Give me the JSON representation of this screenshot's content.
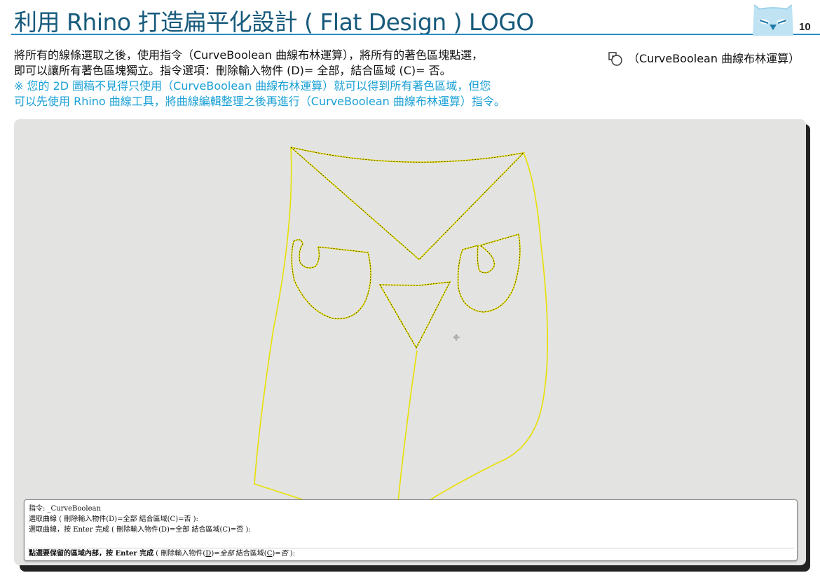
{
  "header": {
    "title": "利用 Rhino 打造扁平化設計 ( Flat Design ) LOGO",
    "page_number": "10"
  },
  "description": {
    "line1": "將所有的線條選取之後，使用指令（CurveBoolean 曲線布林運算），將所有的著色區塊點選，",
    "line2": "即可以讓所有著色區塊獨立。指令選項：刪除輸入物件 (D)= 全部，結合區域 (C)= 否。",
    "note_line1": "※ 您的 2D 圖稿不見得只使用（CurveBoolean 曲線布林運算）就可以得到所有著色區域，但您",
    "note_line2": "可以先使用 Rhino 曲線工具，將曲線編輯整理之後再進行（CurveBoolean 曲線布林運算）指令。"
  },
  "command_reference": {
    "icon": "curve-boolean-icon",
    "label": "（CurveBoolean 曲線布林運算）"
  },
  "command_panel": {
    "history": [
      "指令: _CurveBoolean",
      "選取曲線 ( 刪除輸入物件(D)=全部  結合區域(C)=否 ):",
      "選取曲線，按 Enter 完成 ( 刪除輸入物件(D)=全部  結合區域(C)=否 ):"
    ],
    "prompt_bold": "點選要保留的區域內部，按 Enter 完成",
    "prompt_open": " ( 刪除輸入物件(",
    "opt1_key": "D",
    "opt1_mid": ")=",
    "opt1_value": "全部",
    "opt2_label": "  結合區域(",
    "opt2_key": "C",
    "opt2_mid": ")=",
    "opt2_value": "否",
    "prompt_close": " ):"
  },
  "colors": {
    "title": "#175a7c",
    "note": "#1aa0d6",
    "viewport_bg": "#e3e3e2",
    "curve_yellow": "#e8e000"
  }
}
